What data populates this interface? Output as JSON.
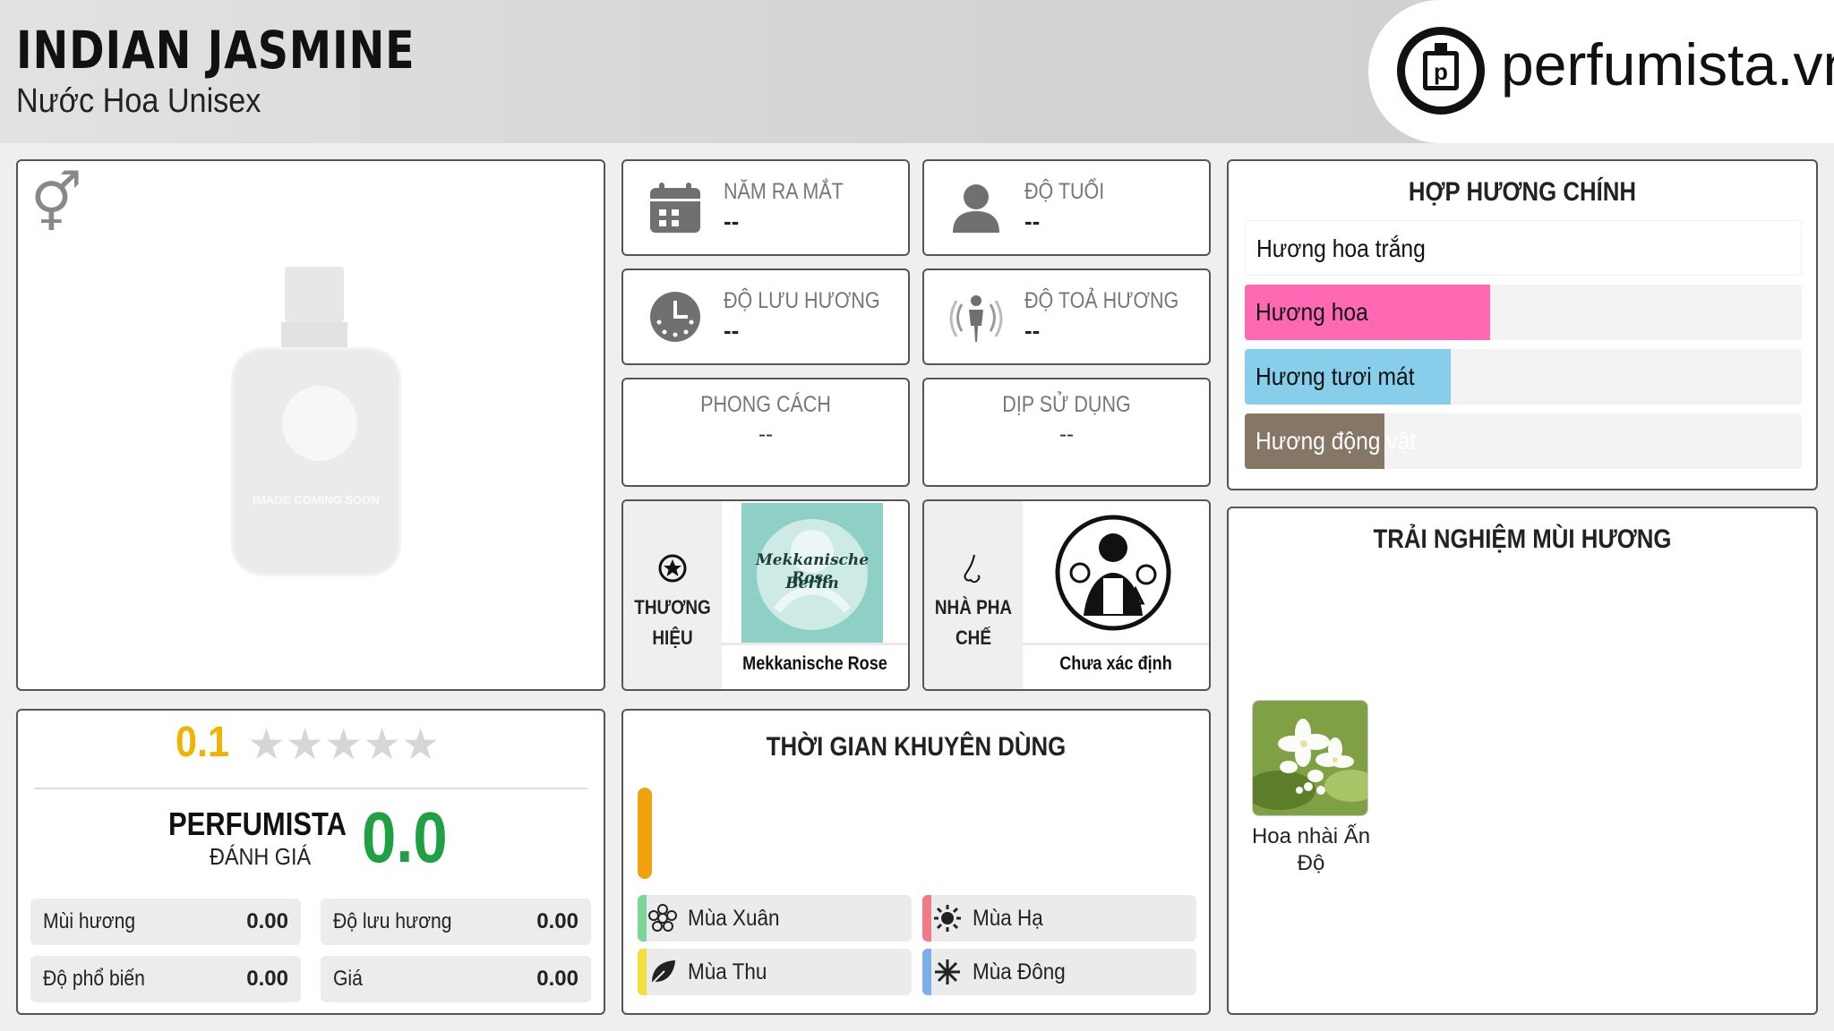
{
  "header": {
    "title": "INDIAN JASMINE",
    "subtitle": "Nước Hoa Unisex",
    "logo_text": "perfumista.vn"
  },
  "image_panel": {
    "gender_icon": "unisex-gender-icon",
    "placeholder_text": "IMAGE COMING SOON"
  },
  "stats": {
    "launch_year": {
      "label": "NĂM RA MẮT",
      "value": "--",
      "icon": "calendar-icon"
    },
    "age": {
      "label": "ĐỘ TUỔI",
      "value": "--",
      "icon": "person-icon"
    },
    "longevity": {
      "label": "ĐỘ LƯU HƯƠNG",
      "value": "--",
      "icon": "clock-icon"
    },
    "sillage": {
      "label": "ĐỘ TOẢ HƯƠNG",
      "value": "--",
      "icon": "diffusion-icon"
    },
    "style": {
      "label": "PHONG CÁCH",
      "value": "--"
    },
    "occasion": {
      "label": "DỊP SỬ DỤNG",
      "value": "--"
    }
  },
  "brand": {
    "label_line1": "THƯƠNG",
    "label_line2": "HIỆU",
    "name": "Mekkanische Rose",
    "logo_line1": "Mekkanische Rose",
    "logo_line2": "Berlin"
  },
  "perfumer": {
    "label_line1": "NHÀ PHA",
    "label_line2": "CHẾ",
    "name": "Chưa xác định"
  },
  "rating": {
    "user_score": "0.1",
    "star_count": 5,
    "filled_stars": 0,
    "brand_label": "PERFUMISTA",
    "brand_sub": "ĐÁNH GIÁ",
    "brand_score": "0.0",
    "metrics": [
      {
        "label": "Mùi hương",
        "value": "0.00"
      },
      {
        "label": "Độ lưu hương",
        "value": "0.00"
      },
      {
        "label": "Độ phổ biến",
        "value": "0.00"
      },
      {
        "label": "Giá",
        "value": "0.00"
      }
    ]
  },
  "time": {
    "title": "THỜI GIAN KHUYÊN DÙNG",
    "seasons": [
      {
        "name": "Mùa Xuân",
        "color": "#7ed59a",
        "icon": "spring-flower-icon"
      },
      {
        "name": "Mùa Hạ",
        "color": "#f07a8a",
        "icon": "sun-icon"
      },
      {
        "name": "Mùa Thu",
        "color": "#f2df3a",
        "icon": "leaf-icon"
      },
      {
        "name": "Mùa Đông",
        "color": "#7eaee8",
        "icon": "snowflake-icon"
      }
    ]
  },
  "accords": {
    "title": "HỢP HƯƠNG CHÍNH",
    "items": [
      {
        "name": "Hương hoa trắng",
        "color": "#ffffff",
        "level": 1.0
      },
      {
        "name": "Hương hoa",
        "color": "#ff69b4",
        "level": 0.44
      },
      {
        "name": "Hương tươi mát",
        "color": "#87ceeb",
        "level": 0.37
      },
      {
        "name": "Hương động vật",
        "color": "#857665",
        "level": 0.25
      }
    ]
  },
  "notes": {
    "title": "TRẢI NGHIỆM MÙI HƯƠNG",
    "items": [
      {
        "name_line1": "Hoa nhài Ấn",
        "name_line2": "Độ"
      }
    ]
  }
}
